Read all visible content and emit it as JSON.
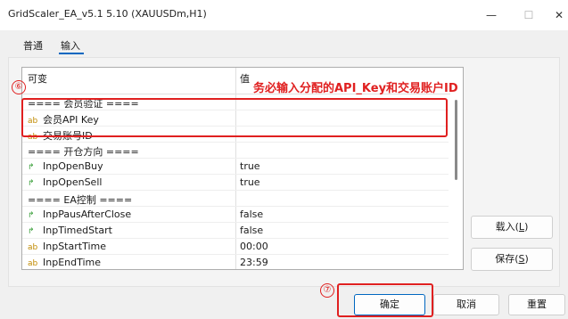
{
  "window": {
    "title": "GridScaler_EA_v5.1 5.10 (XAUUSDm,H1)",
    "min_glyph": "—",
    "max_glyph": "☐",
    "close_glyph": "✕"
  },
  "tabs": [
    {
      "label": "普通"
    },
    {
      "label": "输入"
    }
  ],
  "grid": {
    "col_variable": "可变",
    "col_value": "值",
    "rows": [
      {
        "name": "==== 会员验证 ====",
        "value": "",
        "icon": ""
      },
      {
        "name": "会员API Key",
        "value": "",
        "icon": "ab"
      },
      {
        "name": "交易账号ID",
        "value": "",
        "icon": "ab"
      },
      {
        "name": "==== 开仓方向 ====",
        "value": "",
        "icon": ""
      },
      {
        "name": "InpOpenBuy",
        "value": "true",
        "icon": "arrow"
      },
      {
        "name": "InpOpenSell",
        "value": "true",
        "icon": "arrow"
      },
      {
        "name": "==== EA控制 ====",
        "value": "",
        "icon": ""
      },
      {
        "name": "InpPausAfterClose",
        "value": "false",
        "icon": "arrow"
      },
      {
        "name": "InpTimedStart",
        "value": "false",
        "icon": "arrow"
      },
      {
        "name": "InpStartTime",
        "value": "00:00",
        "icon": "ab"
      },
      {
        "name": "InpEndTime",
        "value": "23:59",
        "icon": "ab"
      }
    ]
  },
  "buttons": {
    "load_label": "载入",
    "load_key": "L",
    "save_label": "保存",
    "save_key": "S",
    "ok_label": "确定",
    "cancel_label": "取消",
    "reset_label": "重置"
  },
  "annotations": {
    "step6": "⑥",
    "step6_text": "务必输入分配的API_Key和交易账户ID",
    "step7": "⑦",
    "color": "#e02020"
  },
  "icons": {
    "ab": "ab",
    "arrow": "↱"
  },
  "colors": {
    "accent": "#0067c0",
    "annotation": "#e02020"
  }
}
